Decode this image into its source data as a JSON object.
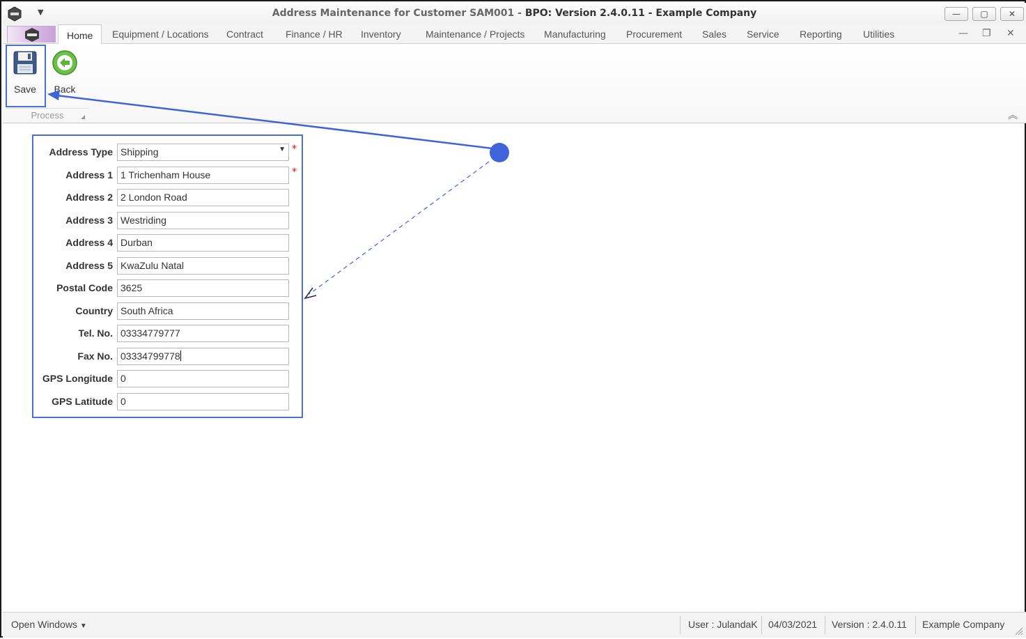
{
  "window": {
    "title_prefix": "Address Maintenance for Customer SAM001 - ",
    "title_main": "BPO: Version 2.4.0.11 - Example Company",
    "minimize_glyph": "—",
    "maximize_glyph": "▢",
    "close_glyph": "✕"
  },
  "tabs": [
    {
      "label": "Home"
    },
    {
      "label": "Equipment / Locations"
    },
    {
      "label": "Contract"
    },
    {
      "label": "Finance / HR"
    },
    {
      "label": "Inventory"
    },
    {
      "label": "Maintenance / Projects"
    },
    {
      "label": "Manufacturing"
    },
    {
      "label": "Procurement"
    },
    {
      "label": "Sales"
    },
    {
      "label": "Service"
    },
    {
      "label": "Reporting"
    },
    {
      "label": "Utilities"
    }
  ],
  "ribbon": {
    "save_label": "Save",
    "back_label": "Back",
    "group_label": "Process"
  },
  "form": {
    "address_type": {
      "label": "Address Type",
      "value": "Shipping"
    },
    "address1": {
      "label": "Address 1",
      "value": "1 Trichenham House"
    },
    "address2": {
      "label": "Address 2",
      "value": "2 London Road"
    },
    "address3": {
      "label": "Address 3",
      "value": "Westriding"
    },
    "address4": {
      "label": "Address 4",
      "value": "Durban"
    },
    "address5": {
      "label": "Address 5",
      "value": "KwaZulu Natal"
    },
    "postal_code": {
      "label": "Postal Code",
      "value": "3625"
    },
    "country": {
      "label": "Country",
      "value": "South Africa"
    },
    "tel": {
      "label": "Tel. No.",
      "value": "03334779777"
    },
    "fax": {
      "label": "Fax No.",
      "value": "03334799778"
    },
    "gps_longitude": {
      "label": "GPS Longitude",
      "value": "0"
    },
    "gps_latitude": {
      "label": "GPS Latitude",
      "value": "0"
    },
    "required_marker": "*"
  },
  "statusbar": {
    "open_windows": "Open Windows",
    "user": "User : JulandaK",
    "date": "04/03/2021",
    "version": "Version : 2.4.0.11",
    "company": "Example Company"
  },
  "colors": {
    "annotation": "#3f63d8",
    "required": "#e00000",
    "back_icon": "#5cb338"
  }
}
